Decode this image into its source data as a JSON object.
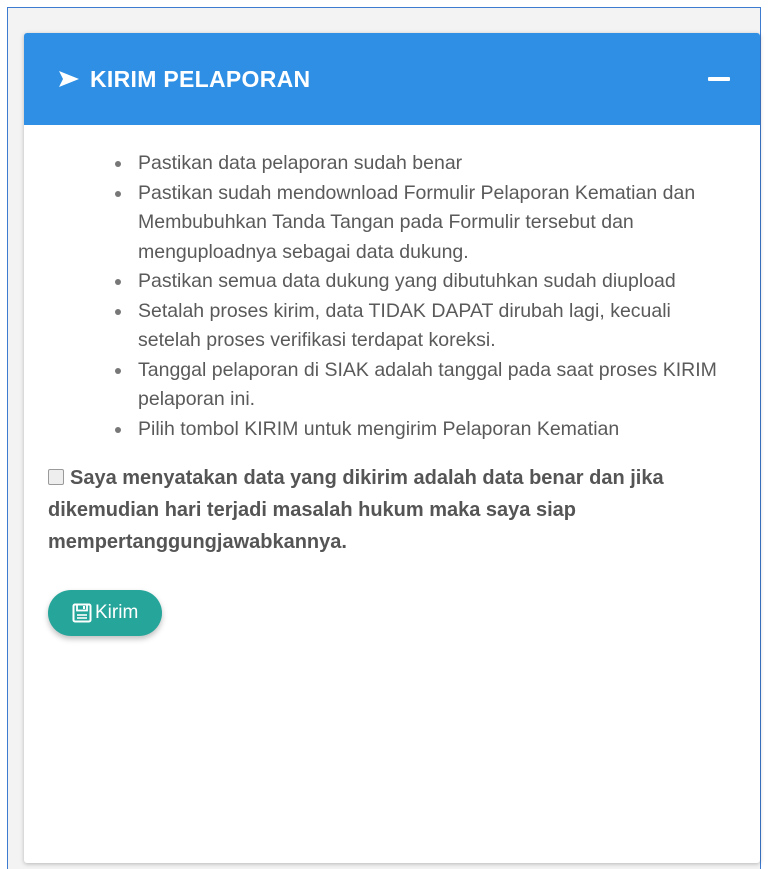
{
  "panel": {
    "title": "KIRIM PELAPORAN",
    "header_icon": "send-arrow-icon",
    "collapse_icon": "minus-icon",
    "header_color": "#2e8fe4"
  },
  "notes": [
    "Pastikan data pelaporan sudah benar",
    "Pastikan sudah mendownload Formulir Pelaporan Kematian dan Membubuhkan Tanda Tangan pada Formulir tersebut dan menguploadnya sebagai data dukung.",
    "Pastikan semua data dukung yang dibutuhkan sudah diupload",
    "Setalah proses kirim, data TIDAK DAPAT dirubah lagi, kecuali setelah proses verifikasi terdapat koreksi.",
    "Tanggal pelaporan di SIAK adalah tanggal pada saat proses KIRIM pelaporan ini.",
    "Pilih tombol KIRIM untuk mengirim Pelaporan Kematian"
  ],
  "agreement": {
    "checked": false,
    "text": "Saya menyatakan data yang dikirim adalah data benar dan jika dikemudian hari terjadi masalah hukum maka saya siap mempertanggungjawabkannya."
  },
  "submit": {
    "label": "Kirim",
    "icon": "save-icon",
    "color": "#26a59a"
  }
}
